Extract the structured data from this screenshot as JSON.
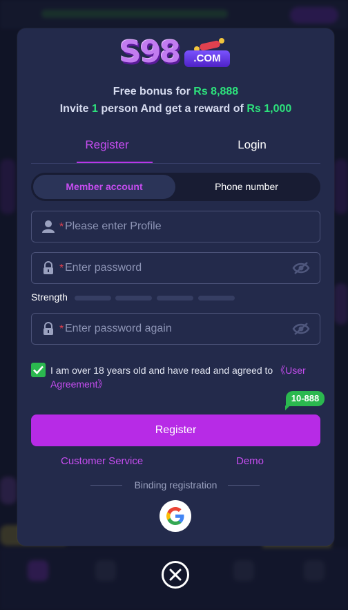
{
  "brand": {
    "logo_main": "S98",
    "logo_suffix": ".COM"
  },
  "bonus": {
    "line1_prefix": "Free bonus for",
    "line1_amount": "Rs 8,888",
    "line2_prefix": "Invite",
    "line2_count": "1",
    "line2_middle": "person And get a reward of",
    "line2_amount": "Rs 1,000"
  },
  "tabs": {
    "register": "Register",
    "login": "Login",
    "active": "Register"
  },
  "account_type": {
    "member": "Member account",
    "phone": "Phone number",
    "selected": "Member account"
  },
  "form": {
    "profile_placeholder": "Please enter Profile",
    "password_placeholder": "Enter password",
    "password_again_placeholder": "Enter password again",
    "required_mark": "*",
    "strength_label": "Strength",
    "strength_level": 0
  },
  "agreement": {
    "checked": true,
    "text": "I am over 18 years old and have read and agreed to",
    "link": "《User Agreement》"
  },
  "promo_badge": "10-888",
  "register_button": "Register",
  "links": {
    "customer_service": "Customer Service",
    "demo": "Demo"
  },
  "binding_label": "Binding registration",
  "icons": {
    "profile": "person-icon",
    "password": "lock-icon",
    "visibility": "eye-off-icon",
    "checkbox": "check-icon",
    "social": "google-icon",
    "close": "close-icon"
  },
  "colors": {
    "accent": "#b72be6",
    "accent_text": "#c64df0",
    "highlight": "#2de27c",
    "success": "#2bb84f",
    "modal_bg": "#232a4b"
  }
}
